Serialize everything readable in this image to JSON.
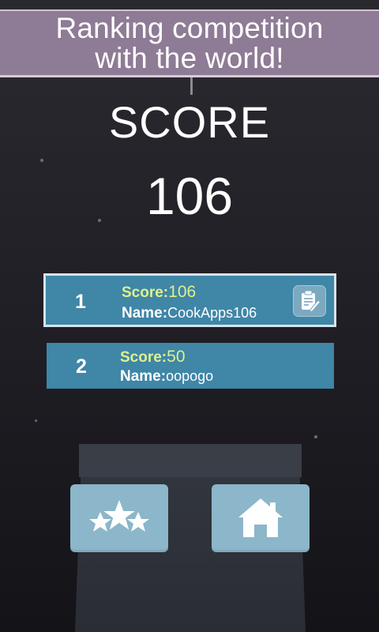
{
  "banner": {
    "line1": "Ranking competition",
    "line2": "with the world!"
  },
  "score_heading": "SCORE",
  "score_value": "106",
  "ranking": [
    {
      "rank": "1",
      "score_label": "Score:",
      "score": "106",
      "name_label": "Name:",
      "name": "CookApps106",
      "selected": true
    },
    {
      "rank": "2",
      "score_label": "Score:",
      "score": "50",
      "name_label": "Name:",
      "name": "oopogo",
      "selected": false
    }
  ],
  "icons": {
    "edit": "clipboard-pencil-icon",
    "leaderboard": "stars-icon",
    "home": "home-icon"
  },
  "colors": {
    "banner": "#8e7b95",
    "row": "#3f86a7",
    "score_text": "#dff08e",
    "button": "#8cb6c9"
  }
}
